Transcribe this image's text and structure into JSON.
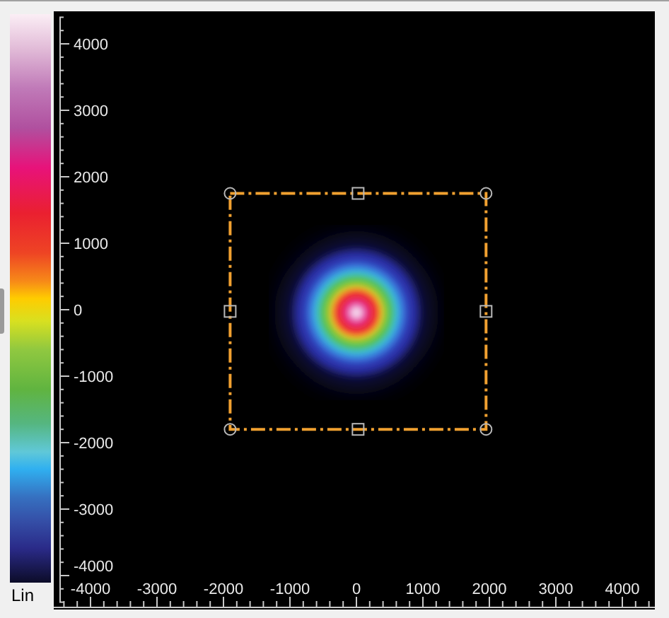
{
  "colorbar": {
    "scale": "Lin"
  },
  "y_axis": {
    "labels": [
      "4000",
      "3000",
      "2000",
      "1000",
      "0",
      "-1000",
      "-2000",
      "-3000",
      "-4000"
    ]
  },
  "x_axis": {
    "labels": [
      "-4000",
      "-3000",
      "-2000",
      "-1000",
      "0",
      "1000",
      "2000",
      "3000",
      "4000"
    ]
  }
}
